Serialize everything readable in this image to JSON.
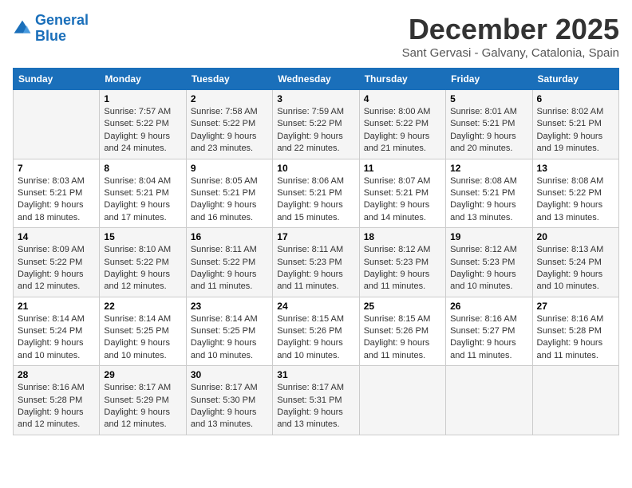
{
  "logo": {
    "line1": "General",
    "line2": "Blue"
  },
  "title": "December 2025",
  "subtitle": "Sant Gervasi - Galvany, Catalonia, Spain",
  "days_of_week": [
    "Sunday",
    "Monday",
    "Tuesday",
    "Wednesday",
    "Thursday",
    "Friday",
    "Saturday"
  ],
  "weeks": [
    [
      {
        "day": "",
        "info": ""
      },
      {
        "day": "1",
        "info": "Sunrise: 7:57 AM\nSunset: 5:22 PM\nDaylight: 9 hours\nand 24 minutes."
      },
      {
        "day": "2",
        "info": "Sunrise: 7:58 AM\nSunset: 5:22 PM\nDaylight: 9 hours\nand 23 minutes."
      },
      {
        "day": "3",
        "info": "Sunrise: 7:59 AM\nSunset: 5:22 PM\nDaylight: 9 hours\nand 22 minutes."
      },
      {
        "day": "4",
        "info": "Sunrise: 8:00 AM\nSunset: 5:22 PM\nDaylight: 9 hours\nand 21 minutes."
      },
      {
        "day": "5",
        "info": "Sunrise: 8:01 AM\nSunset: 5:21 PM\nDaylight: 9 hours\nand 20 minutes."
      },
      {
        "day": "6",
        "info": "Sunrise: 8:02 AM\nSunset: 5:21 PM\nDaylight: 9 hours\nand 19 minutes."
      }
    ],
    [
      {
        "day": "7",
        "info": "Sunrise: 8:03 AM\nSunset: 5:21 PM\nDaylight: 9 hours\nand 18 minutes."
      },
      {
        "day": "8",
        "info": "Sunrise: 8:04 AM\nSunset: 5:21 PM\nDaylight: 9 hours\nand 17 minutes."
      },
      {
        "day": "9",
        "info": "Sunrise: 8:05 AM\nSunset: 5:21 PM\nDaylight: 9 hours\nand 16 minutes."
      },
      {
        "day": "10",
        "info": "Sunrise: 8:06 AM\nSunset: 5:21 PM\nDaylight: 9 hours\nand 15 minutes."
      },
      {
        "day": "11",
        "info": "Sunrise: 8:07 AM\nSunset: 5:21 PM\nDaylight: 9 hours\nand 14 minutes."
      },
      {
        "day": "12",
        "info": "Sunrise: 8:08 AM\nSunset: 5:21 PM\nDaylight: 9 hours\nand 13 minutes."
      },
      {
        "day": "13",
        "info": "Sunrise: 8:08 AM\nSunset: 5:22 PM\nDaylight: 9 hours\nand 13 minutes."
      }
    ],
    [
      {
        "day": "14",
        "info": "Sunrise: 8:09 AM\nSunset: 5:22 PM\nDaylight: 9 hours\nand 12 minutes."
      },
      {
        "day": "15",
        "info": "Sunrise: 8:10 AM\nSunset: 5:22 PM\nDaylight: 9 hours\nand 12 minutes."
      },
      {
        "day": "16",
        "info": "Sunrise: 8:11 AM\nSunset: 5:22 PM\nDaylight: 9 hours\nand 11 minutes."
      },
      {
        "day": "17",
        "info": "Sunrise: 8:11 AM\nSunset: 5:23 PM\nDaylight: 9 hours\nand 11 minutes."
      },
      {
        "day": "18",
        "info": "Sunrise: 8:12 AM\nSunset: 5:23 PM\nDaylight: 9 hours\nand 11 minutes."
      },
      {
        "day": "19",
        "info": "Sunrise: 8:12 AM\nSunset: 5:23 PM\nDaylight: 9 hours\nand 10 minutes."
      },
      {
        "day": "20",
        "info": "Sunrise: 8:13 AM\nSunset: 5:24 PM\nDaylight: 9 hours\nand 10 minutes."
      }
    ],
    [
      {
        "day": "21",
        "info": "Sunrise: 8:14 AM\nSunset: 5:24 PM\nDaylight: 9 hours\nand 10 minutes."
      },
      {
        "day": "22",
        "info": "Sunrise: 8:14 AM\nSunset: 5:25 PM\nDaylight: 9 hours\nand 10 minutes."
      },
      {
        "day": "23",
        "info": "Sunrise: 8:14 AM\nSunset: 5:25 PM\nDaylight: 9 hours\nand 10 minutes."
      },
      {
        "day": "24",
        "info": "Sunrise: 8:15 AM\nSunset: 5:26 PM\nDaylight: 9 hours\nand 10 minutes."
      },
      {
        "day": "25",
        "info": "Sunrise: 8:15 AM\nSunset: 5:26 PM\nDaylight: 9 hours\nand 11 minutes."
      },
      {
        "day": "26",
        "info": "Sunrise: 8:16 AM\nSunset: 5:27 PM\nDaylight: 9 hours\nand 11 minutes."
      },
      {
        "day": "27",
        "info": "Sunrise: 8:16 AM\nSunset: 5:28 PM\nDaylight: 9 hours\nand 11 minutes."
      }
    ],
    [
      {
        "day": "28",
        "info": "Sunrise: 8:16 AM\nSunset: 5:28 PM\nDaylight: 9 hours\nand 12 minutes."
      },
      {
        "day": "29",
        "info": "Sunrise: 8:17 AM\nSunset: 5:29 PM\nDaylight: 9 hours\nand 12 minutes."
      },
      {
        "day": "30",
        "info": "Sunrise: 8:17 AM\nSunset: 5:30 PM\nDaylight: 9 hours\nand 13 minutes."
      },
      {
        "day": "31",
        "info": "Sunrise: 8:17 AM\nSunset: 5:31 PM\nDaylight: 9 hours\nand 13 minutes."
      },
      {
        "day": "",
        "info": ""
      },
      {
        "day": "",
        "info": ""
      },
      {
        "day": "",
        "info": ""
      }
    ]
  ]
}
